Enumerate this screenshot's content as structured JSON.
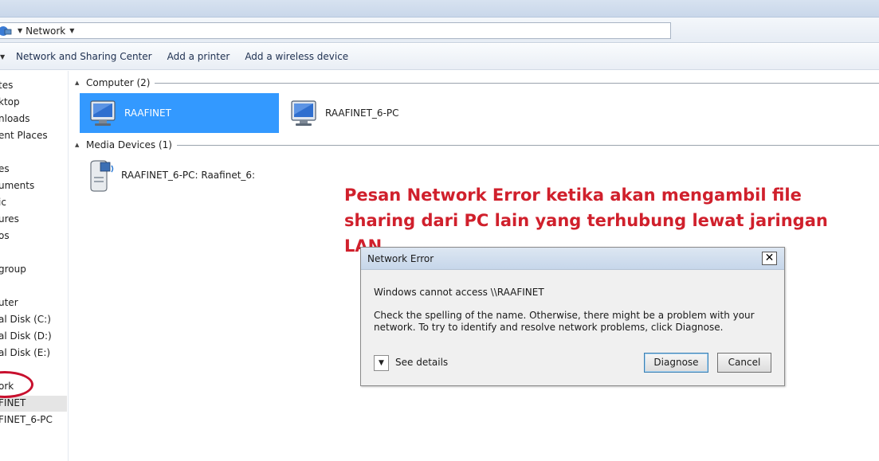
{
  "address": {
    "location": "Network"
  },
  "commands": [
    "Network and Sharing Center",
    "Add a printer",
    "Add a wireless device"
  ],
  "nav": {
    "items": [
      "tes",
      "ktop",
      "nloads",
      "ent Places",
      "es",
      "uments",
      "ic",
      "ures",
      "os",
      "group",
      "uter",
      "al Disk (C:)",
      "al Disk (D:)",
      "al Disk (E:)",
      "ork",
      "FINET",
      "FINET_6-PC"
    ],
    "selected": "FINET"
  },
  "groups": {
    "computer": {
      "label": "Computer (2)",
      "items": [
        "RAAFINET",
        "RAAFINET_6-PC"
      ]
    },
    "media": {
      "label": "Media Devices (1)",
      "items": [
        "RAAFINET_6-PC: Raafinet_6:"
      ]
    }
  },
  "annotation": {
    "line1": "Pesan Network Error ketika akan mengambil file",
    "line2": "sharing dari PC lain yang terhubung lewat jaringan LAN"
  },
  "dialog": {
    "title": "Network Error",
    "close": "✕",
    "heading": "Windows cannot access \\\\RAAFINET",
    "message": "Check the spelling of the name. Otherwise, there might be a problem with your network. To try to identify and resolve network problems, click Diagnose.",
    "details_label": "See details",
    "diagnose_label": "Diagnose",
    "cancel_label": "Cancel"
  },
  "colors": {
    "selection": "#3399ff",
    "annotation": "#d0202c"
  }
}
